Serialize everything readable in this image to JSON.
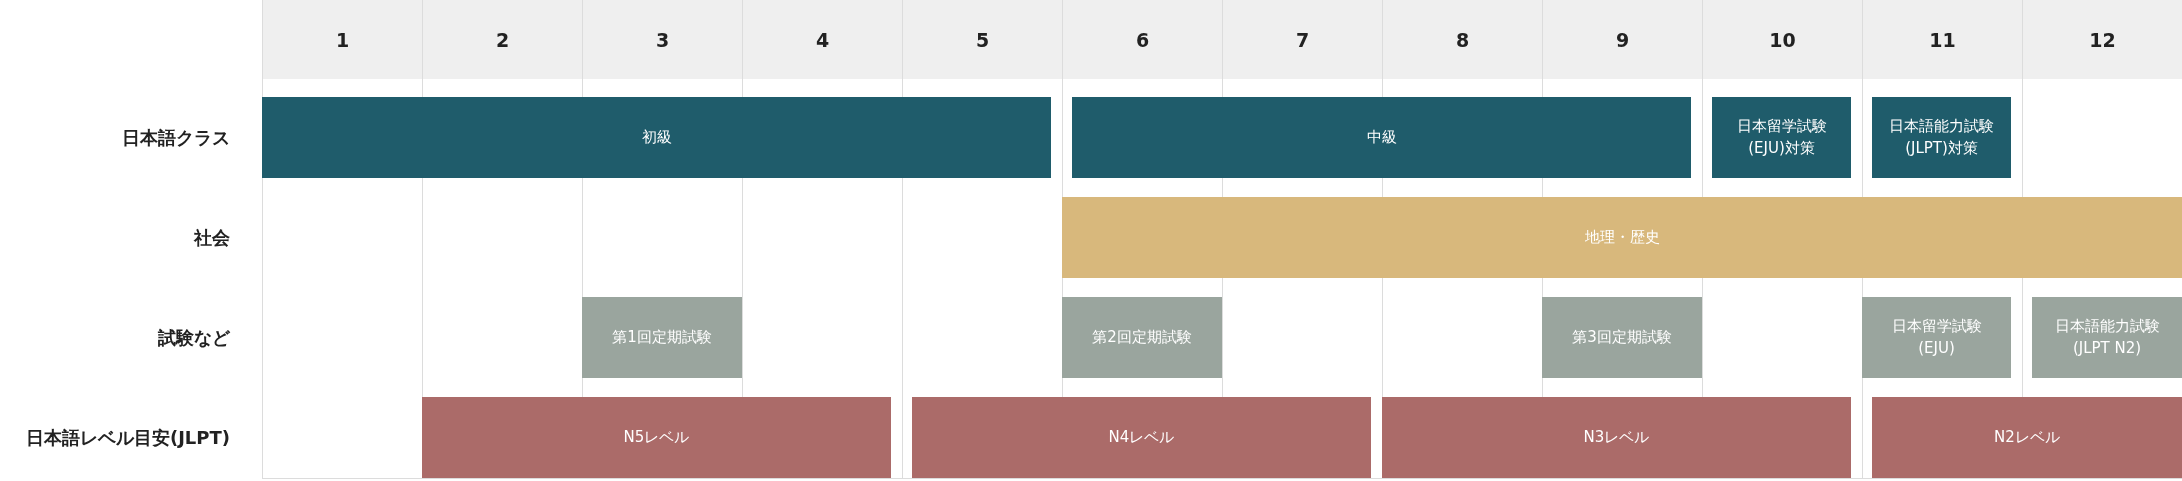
{
  "months": [
    "1",
    "2",
    "3",
    "4",
    "5",
    "6",
    "7",
    "8",
    "9",
    "10",
    "11",
    "12"
  ],
  "rows": [
    {
      "label": "日本語クラス",
      "color": "#1f5c6b",
      "bars": [
        {
          "text": "初級"
        },
        {
          "text": "中級"
        },
        {
          "text": "日本留学試験\n(EJU)対策"
        },
        {
          "text": "日本語能力試験\n(JLPT)対策"
        }
      ]
    },
    {
      "label": "社会",
      "color": "#d8b87c",
      "bars": [
        {
          "text": "地理・歴史"
        }
      ]
    },
    {
      "label": "試験など",
      "color": "#9aa59e",
      "bars": [
        {
          "text": "第1回定期試験"
        },
        {
          "text": "第2回定期試験"
        },
        {
          "text": "第3回定期試験"
        },
        {
          "text": "日本留学試験\n(EJU)"
        },
        {
          "text": "日本語能力試験\n(JLPT N2)"
        }
      ]
    },
    {
      "label": "日本語レベル目安(JLPT)",
      "color": "#ab6b69",
      "bars": [
        {
          "text": "N5レベル"
        },
        {
          "text": "N4レベル"
        },
        {
          "text": "N3レベル"
        },
        {
          "text": "N2レベル"
        }
      ]
    }
  ]
}
